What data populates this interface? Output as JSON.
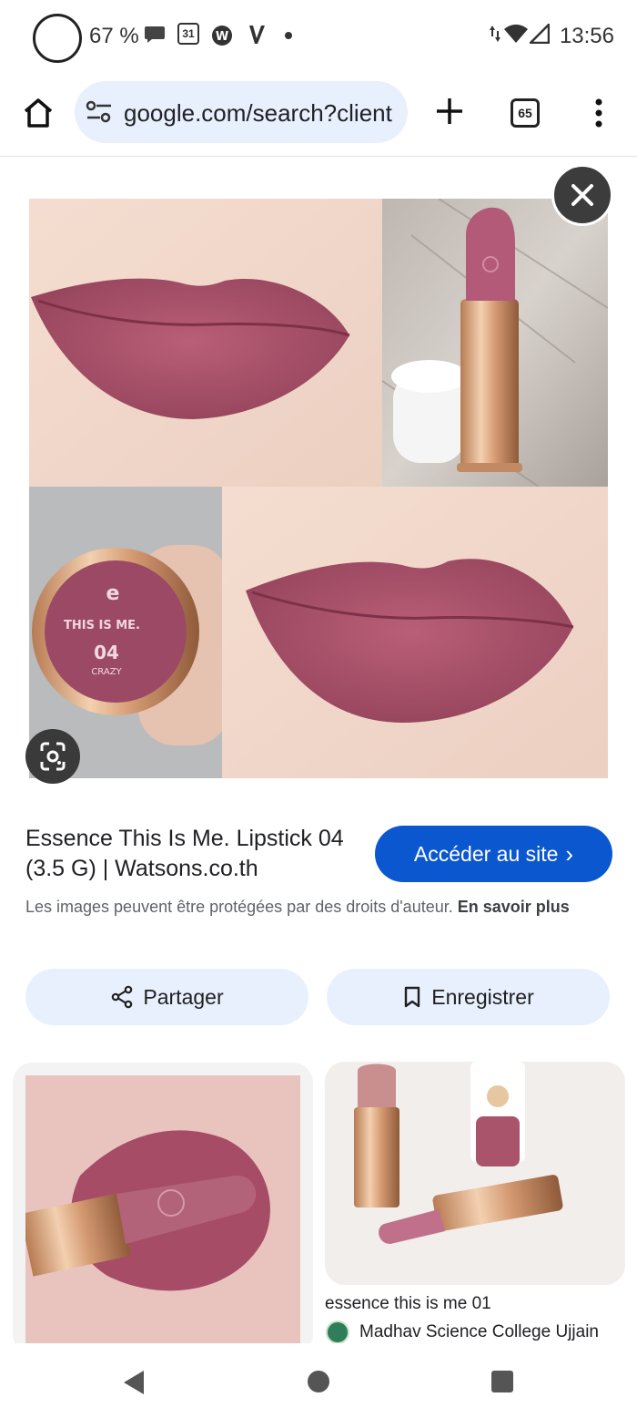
{
  "status_bar": {
    "battery": "67 %",
    "time": "13:56",
    "calendar_day": "31"
  },
  "browser": {
    "url": "google.com/search?client",
    "tab_count": "65"
  },
  "collage": {
    "lipstick_cap_brand": "THIS IS ME.",
    "lipstick_cap_shade": "04",
    "lipstick_cap_name": "CRAZY"
  },
  "result": {
    "title": "Essence This Is Me. Lipstick 04 (3.5 G) | Watsons.co.th",
    "visit_button": "Accéder au site",
    "visit_chevron": "›",
    "copyright_text": "Les images peuvent être protégées par des droits d'auteur.",
    "learn_more": "En savoir plus",
    "share_label": "Partager",
    "save_label": "Enregistrer"
  },
  "related": [
    {
      "title": "essence this is me 01",
      "site": "Madhav Science College Ujjain"
    }
  ],
  "icons": {
    "status": [
      "battery-ring-icon",
      "chat-bubble-icon",
      "calendar-icon",
      "w-app-icon",
      "v-app-icon",
      "dot-icon",
      "data-arrows-icon",
      "wifi-icon",
      "signal-icon"
    ],
    "toolbar": [
      "home-icon",
      "site-settings-icon",
      "new-tab-icon",
      "tab-switcher-icon",
      "more-vert-icon"
    ],
    "overlay": [
      "close-icon",
      "google-lens-icon"
    ],
    "nav": [
      "back-icon",
      "home-circle-icon",
      "recents-icon"
    ]
  },
  "colors": {
    "primary_button": "#0b57d0",
    "tonal_button": "#e8f0fe",
    "lipstick": "#a04c66"
  }
}
